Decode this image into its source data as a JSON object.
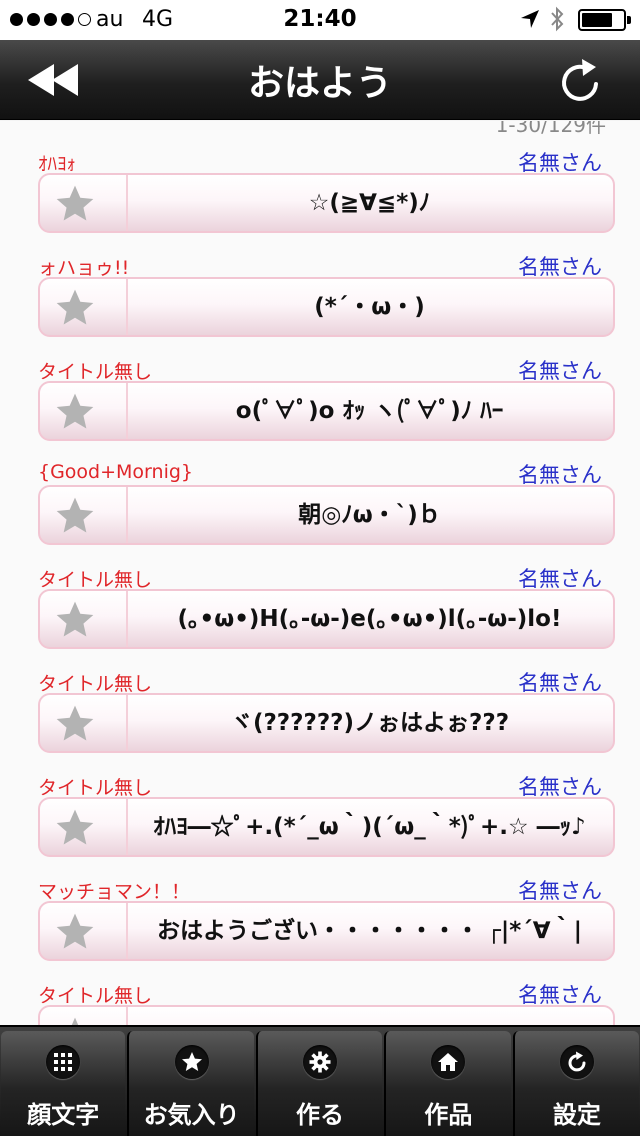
{
  "status": {
    "carrier": "au",
    "network": "4G",
    "time": "21:40"
  },
  "navbar": {
    "title": "おはよう"
  },
  "counter": "1-30/129件",
  "entries": [
    {
      "title": "ｵﾊﾖｫ",
      "author": "名無さん",
      "face": "☆(≧∀≦*)ﾉ"
    },
    {
      "title": "ォハョゥ!!",
      "author": "名無さん",
      "face": "(*´・ω・)"
    },
    {
      "title": "タイトル無し",
      "author": "名無さん",
      "face": "o(ﾟ∀ﾟ)o ｵｯ ヽ(ﾟ∀ﾟ)ﾉ ﾊｰ"
    },
    {
      "title": "{Good+Mornig}",
      "author": "名無さん",
      "face": "朝◎ﾉω・`)ｂ"
    },
    {
      "title": "タイトル無し",
      "author": "名無さん",
      "face": "(｡•ω•)H(｡-ω-)e(｡•ω•)l(｡-ω-)lo!"
    },
    {
      "title": "タイトル無し",
      "author": "名無さん",
      "face": "ヾ(??????)ノぉはよぉ???"
    },
    {
      "title": "タイトル無し",
      "author": "名無さん",
      "face": "ｵﾊﾖ―☆ﾟ+.(*´_ω｀)(´ω_｀*)ﾟ+.☆ ―ｯ♪"
    },
    {
      "title": "マッチョマン！！",
      "author": "名無さん",
      "face": "おはようござい・・・・・・・ ┌|*´∀｀|"
    },
    {
      "title": "タイトル無し",
      "author": "名無さん",
      "face": ""
    }
  ],
  "tabs": [
    {
      "label": "顔文字",
      "icon": "grid-icon"
    },
    {
      "label": "お気入り",
      "icon": "star-icon"
    },
    {
      "label": "作る",
      "icon": "gear-icon"
    },
    {
      "label": "作品",
      "icon": "home-icon"
    },
    {
      "label": "設定",
      "icon": "refresh-icon"
    }
  ]
}
